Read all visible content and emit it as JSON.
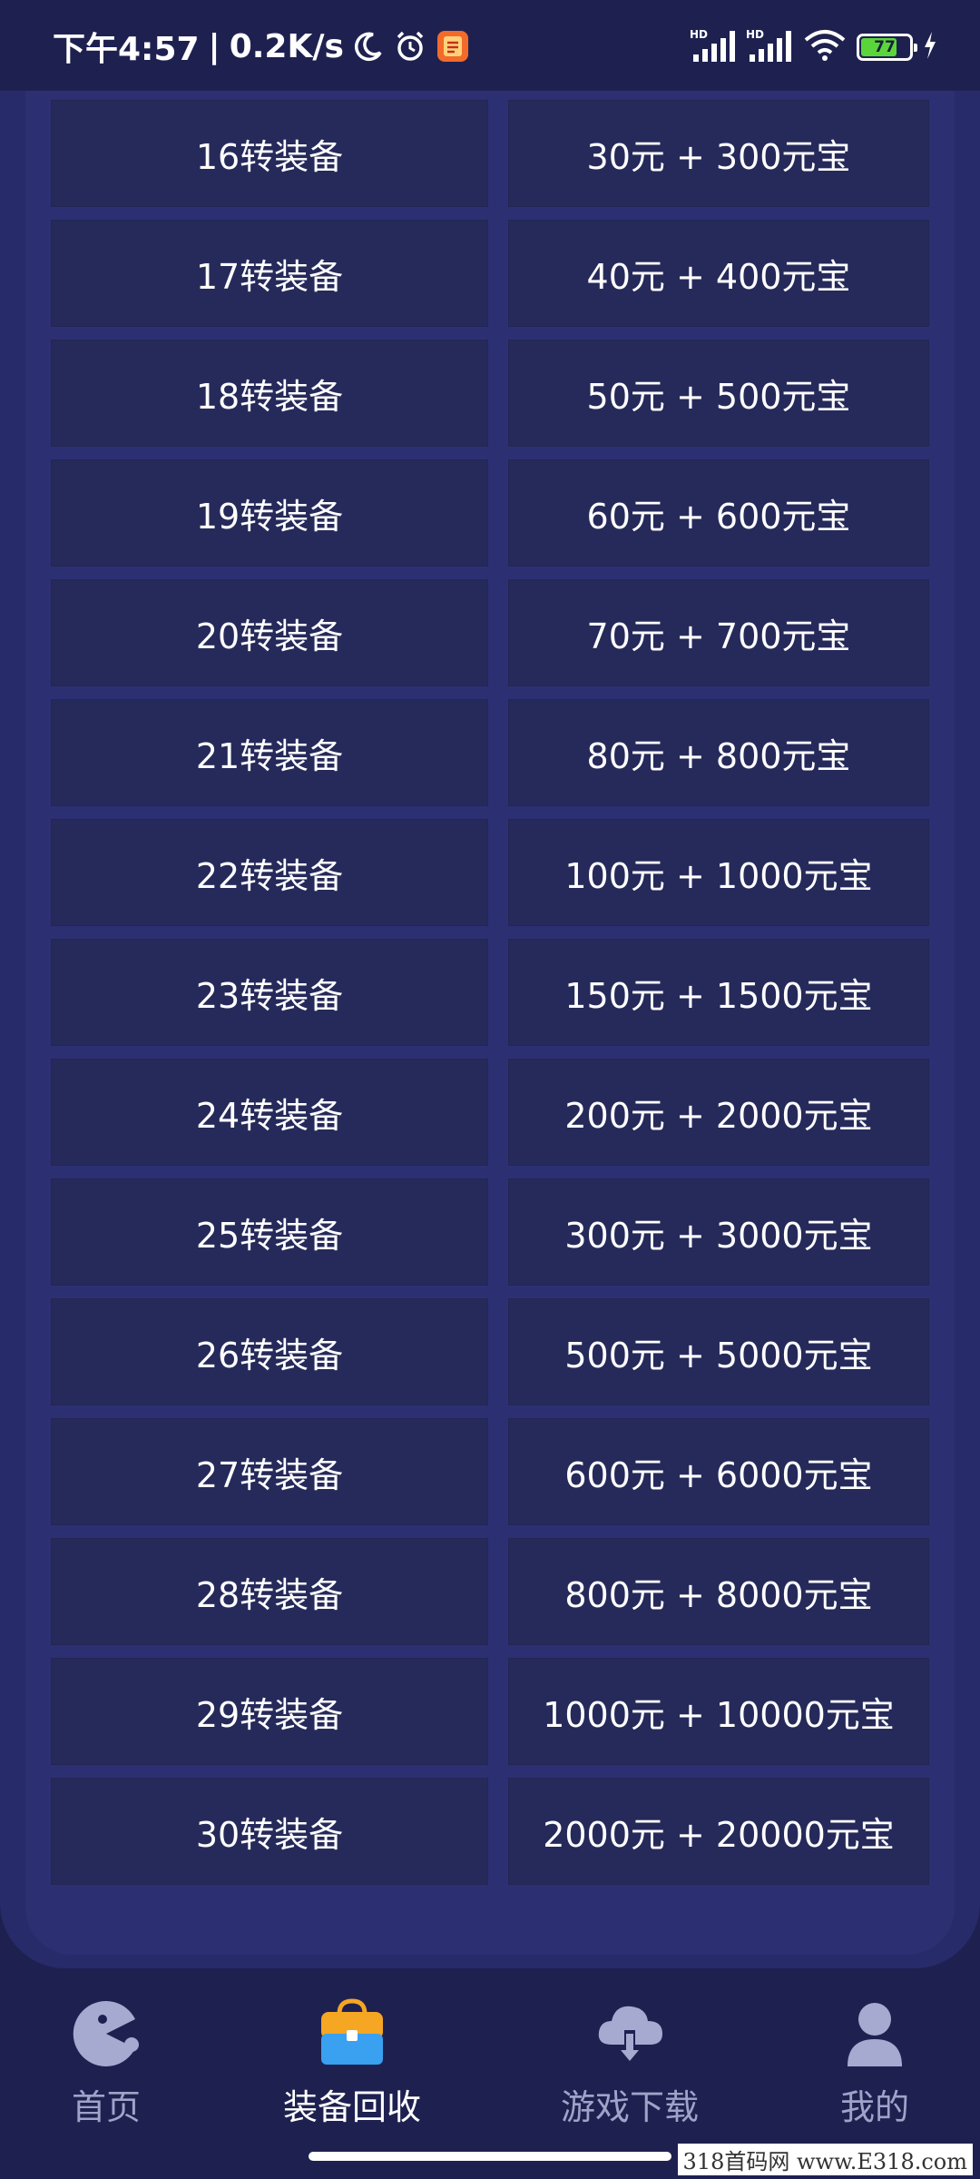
{
  "status_bar": {
    "time": "下午4:57",
    "network_speed": "0.2K/s",
    "separator": "|",
    "battery_level": "77",
    "icons": [
      "moon-icon",
      "alarm-icon",
      "app-notification-icon",
      "hd-signal-icon",
      "hd-signal-icon",
      "wifi-icon",
      "battery-icon",
      "charging-icon"
    ]
  },
  "table": {
    "rows": [
      {
        "level": "16转装备",
        "price": "30元 + 300元宝"
      },
      {
        "level": "17转装备",
        "price": "40元 + 400元宝"
      },
      {
        "level": "18转装备",
        "price": "50元 + 500元宝"
      },
      {
        "level": "19转装备",
        "price": "60元 + 600元宝"
      },
      {
        "level": "20转装备",
        "price": "70元 + 700元宝"
      },
      {
        "level": "21转装备",
        "price": "80元 + 800元宝"
      },
      {
        "level": "22转装备",
        "price": "100元 + 1000元宝"
      },
      {
        "level": "23转装备",
        "price": "150元 + 1500元宝"
      },
      {
        "level": "24转装备",
        "price": "200元 + 2000元宝"
      },
      {
        "level": "25转装备",
        "price": "300元 + 3000元宝"
      },
      {
        "level": "26转装备",
        "price": "500元 + 5000元宝"
      },
      {
        "level": "27转装备",
        "price": "600元 + 6000元宝"
      },
      {
        "level": "28转装备",
        "price": "800元 + 8000元宝"
      },
      {
        "level": "29转装备",
        "price": "1000元 + 10000元宝"
      },
      {
        "level": "30转装备",
        "price": "2000元 + 20000元宝"
      }
    ]
  },
  "bottom_nav": {
    "items": [
      {
        "label": "首页",
        "icon": "pacman-home-icon",
        "active": false
      },
      {
        "label": "装备回收",
        "icon": "bag-icon",
        "active": true
      },
      {
        "label": "游戏下载",
        "icon": "cloud-download-icon",
        "active": false
      },
      {
        "label": "我的",
        "icon": "user-icon",
        "active": false
      }
    ]
  },
  "watermark": "318首码网 www.E318.com",
  "colors": {
    "background": "#1e2150",
    "panel": "#272b6a",
    "cell": "#262a5a",
    "nav_inactive": "#9fa3c8",
    "battery": "#5bd63a",
    "bag_orange": "#f5a623",
    "bag_blue": "#3aa0f0"
  }
}
